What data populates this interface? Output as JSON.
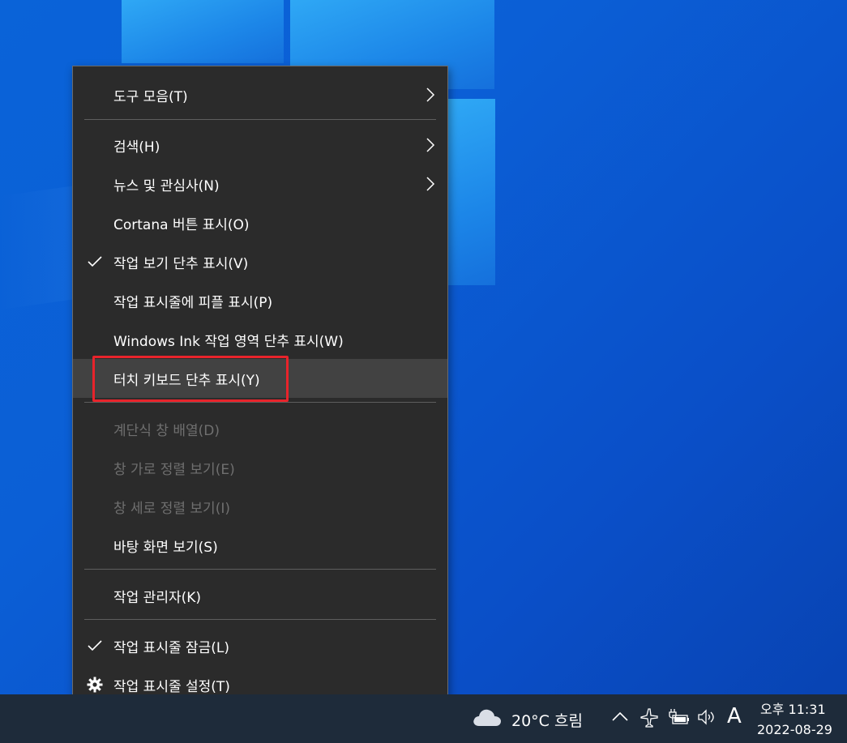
{
  "context_menu": {
    "items": [
      {
        "label": "도구 모음(T)",
        "submenu": true
      },
      {
        "label": "검색(H)",
        "submenu": true
      },
      {
        "label": "뉴스 및 관심사(N)",
        "submenu": true
      },
      {
        "label": "Cortana 버튼 표시(O)"
      },
      {
        "label": "작업 보기 단추 표시(V)",
        "checked": true
      },
      {
        "label": "작업 표시줄에 피플 표시(P)"
      },
      {
        "label": "Windows Ink 작업 영역 단추 표시(W)"
      },
      {
        "label": "터치 키보드 단추 표시(Y)",
        "highlighted": true
      },
      {
        "label": "계단식 창 배열(D)",
        "disabled": true
      },
      {
        "label": "창 가로 정렬 보기(E)",
        "disabled": true
      },
      {
        "label": "창 세로 정렬 보기(I)",
        "disabled": true
      },
      {
        "label": "바탕 화면 보기(S)"
      },
      {
        "label": "작업 관리자(K)"
      },
      {
        "label": "작업 표시줄 잠금(L)",
        "checked": true
      },
      {
        "label": "작업 표시줄 설정(T)",
        "icon": "gear-icon"
      }
    ]
  },
  "taskbar": {
    "weather": {
      "text": "20°C 흐림",
      "icon": "cloud-icon"
    },
    "tray_icons": [
      "chevron-up-icon",
      "airplane-mode-icon",
      "battery-charging-icon",
      "volume-icon"
    ],
    "ime_indicator": "A",
    "clock": {
      "time": "오후 11:31",
      "date": "2022-08-29"
    }
  },
  "colors": {
    "menu_bg": "#2b2b2b",
    "menu_hover": "#424242",
    "highlight_outline": "#e8232b",
    "taskbar_bg": "#1e2b3a",
    "desktop_bg": "#0a5fd6"
  }
}
